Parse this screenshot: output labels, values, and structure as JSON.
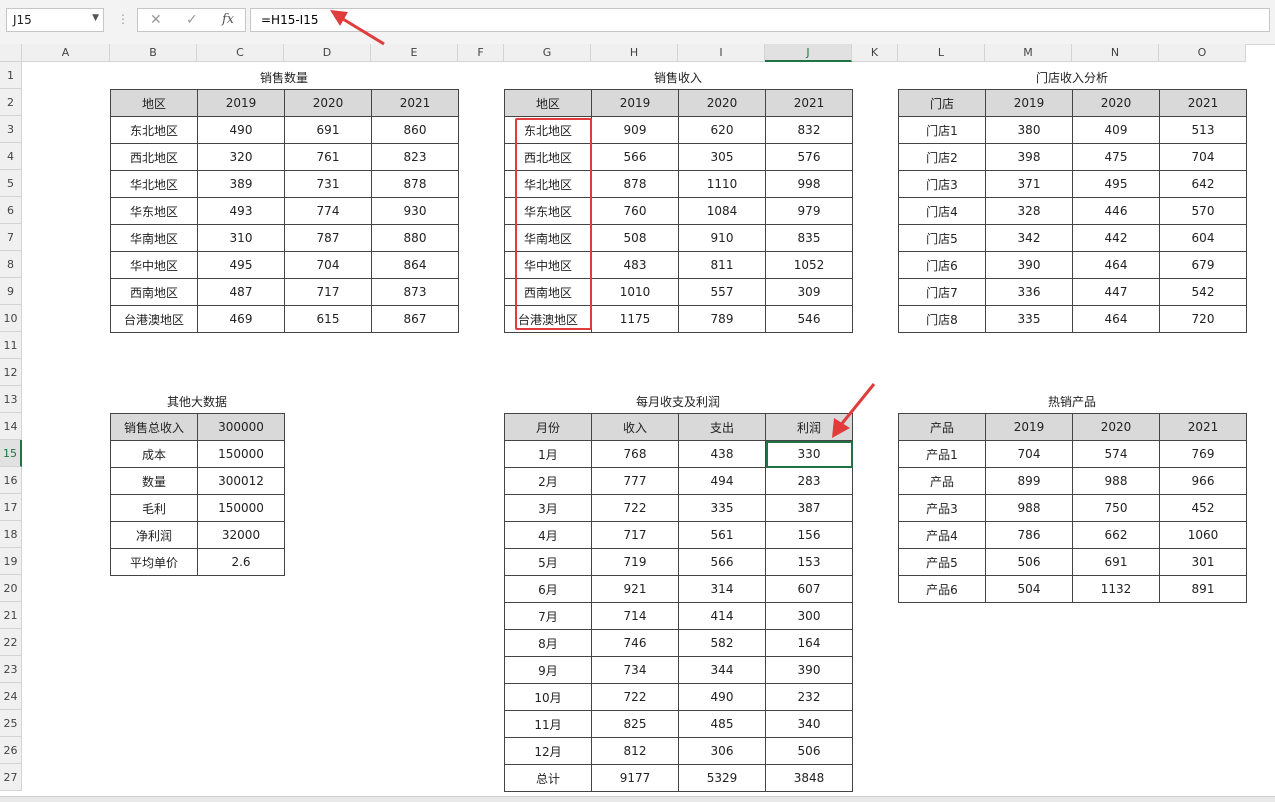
{
  "formula_bar": {
    "name_box": "J15",
    "cancel_icon": "✕",
    "confirm_icon": "✓",
    "fx_icon": "fx",
    "formula": "=H15-I15"
  },
  "columns": [
    "A",
    "B",
    "C",
    "D",
    "E",
    "F",
    "G",
    "H",
    "I",
    "J",
    "K",
    "L",
    "M",
    "N",
    "O"
  ],
  "rows": [
    "1",
    "2",
    "3",
    "4",
    "5",
    "6",
    "7",
    "8",
    "9",
    "10",
    "11",
    "12",
    "13",
    "14",
    "15",
    "16",
    "17",
    "18",
    "19",
    "20",
    "21",
    "22",
    "23",
    "24",
    "25",
    "26",
    "27"
  ],
  "selected_cell": "J15",
  "accent_color": "#217346",
  "annotation_color": "#e03c3c",
  "sales_qty": {
    "title": "销售数量",
    "header": [
      "地区",
      "2019",
      "2020",
      "2021"
    ],
    "rows": [
      [
        "东北地区",
        "490",
        "691",
        "860"
      ],
      [
        "西北地区",
        "320",
        "761",
        "823"
      ],
      [
        "华北地区",
        "389",
        "731",
        "878"
      ],
      [
        "华东地区",
        "493",
        "774",
        "930"
      ],
      [
        "华南地区",
        "310",
        "787",
        "880"
      ],
      [
        "华中地区",
        "495",
        "704",
        "864"
      ],
      [
        "西南地区",
        "487",
        "717",
        "873"
      ],
      [
        "台港澳地区",
        "469",
        "615",
        "867"
      ]
    ]
  },
  "sales_rev": {
    "title": "销售收入",
    "header": [
      "地区",
      "2019",
      "2020",
      "2021"
    ],
    "rows": [
      [
        "东北地区",
        "909",
        "620",
        "832"
      ],
      [
        "西北地区",
        "566",
        "305",
        "576"
      ],
      [
        "华北地区",
        "878",
        "1110",
        "998"
      ],
      [
        "华东地区",
        "760",
        "1084",
        "979"
      ],
      [
        "华南地区",
        "508",
        "910",
        "835"
      ],
      [
        "华中地区",
        "483",
        "811",
        "1052"
      ],
      [
        "西南地区",
        "1010",
        "557",
        "309"
      ],
      [
        "台港澳地区",
        "1175",
        "789",
        "546"
      ]
    ]
  },
  "store_rev": {
    "title": "门店收入分析",
    "header": [
      "门店",
      "2019",
      "2020",
      "2021"
    ],
    "rows": [
      [
        "门店1",
        "380",
        "409",
        "513"
      ],
      [
        "门店2",
        "398",
        "475",
        "704"
      ],
      [
        "门店3",
        "371",
        "495",
        "642"
      ],
      [
        "门店4",
        "328",
        "446",
        "570"
      ],
      [
        "门店5",
        "342",
        "442",
        "604"
      ],
      [
        "门店6",
        "390",
        "464",
        "679"
      ],
      [
        "门店7",
        "336",
        "447",
        "542"
      ],
      [
        "门店8",
        "335",
        "464",
        "720"
      ]
    ]
  },
  "other_data": {
    "title": "其他大数据",
    "rows": [
      [
        "销售总收入",
        "300000"
      ],
      [
        "成本",
        "150000"
      ],
      [
        "数量",
        "300012"
      ],
      [
        "毛利",
        "150000"
      ],
      [
        "净利润",
        "32000"
      ],
      [
        "平均单价",
        "2.6"
      ]
    ]
  },
  "monthly": {
    "title": "每月收支及利润",
    "header": [
      "月份",
      "收入",
      "支出",
      "利润"
    ],
    "rows": [
      [
        "1月",
        "768",
        "438",
        "330"
      ],
      [
        "2月",
        "777",
        "494",
        "283"
      ],
      [
        "3月",
        "722",
        "335",
        "387"
      ],
      [
        "4月",
        "717",
        "561",
        "156"
      ],
      [
        "5月",
        "719",
        "566",
        "153"
      ],
      [
        "6月",
        "921",
        "314",
        "607"
      ],
      [
        "7月",
        "714",
        "414",
        "300"
      ],
      [
        "8月",
        "746",
        "582",
        "164"
      ],
      [
        "9月",
        "734",
        "344",
        "390"
      ],
      [
        "10月",
        "722",
        "490",
        "232"
      ],
      [
        "11月",
        "825",
        "485",
        "340"
      ],
      [
        "12月",
        "812",
        "306",
        "506"
      ],
      [
        "总计",
        "9177",
        "5329",
        "3848"
      ]
    ]
  },
  "hot_products": {
    "title": "热销产品",
    "header": [
      "产品",
      "2019",
      "2020",
      "2021"
    ],
    "rows": [
      [
        "产品1",
        "704",
        "574",
        "769"
      ],
      [
        "产品",
        "899",
        "988",
        "966"
      ],
      [
        "产品3",
        "988",
        "750",
        "452"
      ],
      [
        "产品4",
        "786",
        "662",
        "1060"
      ],
      [
        "产品5",
        "506",
        "691",
        "301"
      ],
      [
        "产品6",
        "504",
        "1132",
        "891"
      ]
    ]
  }
}
